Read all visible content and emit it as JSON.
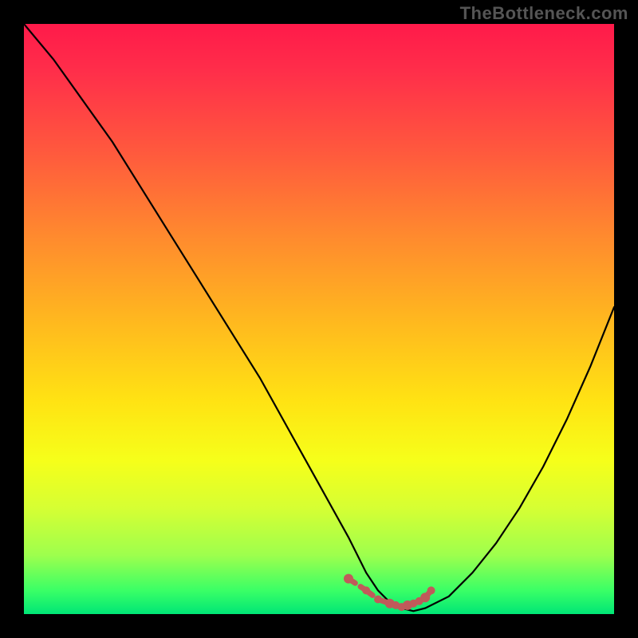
{
  "watermark": "TheBottleneck.com",
  "chart_data": {
    "type": "line",
    "title": "",
    "xlabel": "",
    "ylabel": "",
    "xlim": [
      0,
      100
    ],
    "ylim": [
      0,
      100
    ],
    "series": [
      {
        "name": "curve",
        "x": [
          0,
          5,
          10,
          15,
          20,
          25,
          30,
          35,
          40,
          45,
          50,
          55,
          58,
          60,
          62,
          64,
          66,
          68,
          72,
          76,
          80,
          84,
          88,
          92,
          96,
          100
        ],
        "values": [
          100,
          94,
          87,
          80,
          72,
          64,
          56,
          48,
          40,
          31,
          22,
          13,
          7,
          4,
          2,
          1,
          0.5,
          1,
          3,
          7,
          12,
          18,
          25,
          33,
          42,
          52
        ]
      }
    ],
    "markers": {
      "name": "bottom-dots",
      "color": "#c05a5a",
      "x": [
        55,
        58,
        60,
        62,
        63,
        64,
        65,
        66,
        67,
        68,
        69
      ],
      "values": [
        6,
        4,
        2.5,
        1.8,
        1.5,
        1.2,
        1.5,
        1.8,
        2.2,
        2.8,
        4
      ]
    },
    "background_gradient": {
      "top": "#ff1a4a",
      "mid": "#fff41a",
      "bottom": "#00e676"
    }
  }
}
